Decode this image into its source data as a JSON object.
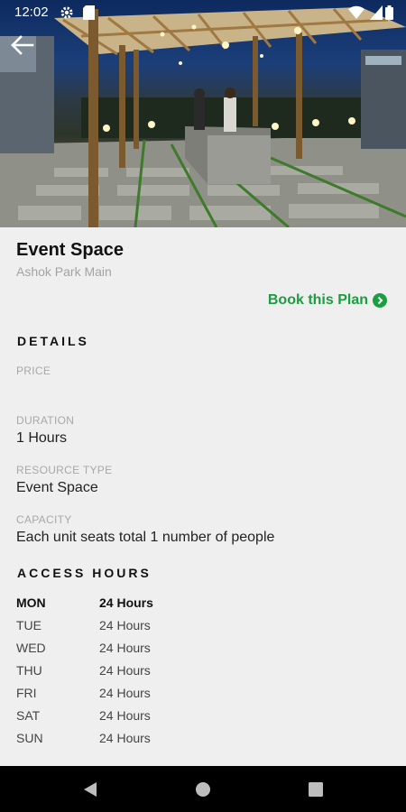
{
  "status_bar": {
    "time": "12:02"
  },
  "hero": {
    "image_description_icon": "photo-icon"
  },
  "header": {
    "back_icon": "arrow-left-icon"
  },
  "space": {
    "title": "Event Space",
    "subtitle": "Ashok Park Main",
    "book_label": "Book this Plan"
  },
  "details": {
    "heading": "DETAILS",
    "price_label": "PRICE",
    "price_value": "",
    "duration_label": "DURATION",
    "duration_value": "1 Hours",
    "resource_type_label": "RESOURCE TYPE",
    "resource_type_value": "Event Space",
    "capacity_label": "CAPACITY",
    "capacity_value": "Each unit seats total 1 number of people"
  },
  "access_hours": {
    "heading": "ACCESS HOURS",
    "rows": [
      {
        "day": "MON",
        "hours": "24 Hours"
      },
      {
        "day": "TUE",
        "hours": "24 Hours"
      },
      {
        "day": "WED",
        "hours": "24 Hours"
      },
      {
        "day": "THU",
        "hours": "24 Hours"
      },
      {
        "day": "FRI",
        "hours": "24 Hours"
      },
      {
        "day": "SAT",
        "hours": "24 Hours"
      },
      {
        "day": "SUN",
        "hours": "24 Hours"
      }
    ]
  },
  "colors": {
    "accent": "#1a9e3f",
    "background": "#efefef",
    "nav_bar": "#000000"
  }
}
